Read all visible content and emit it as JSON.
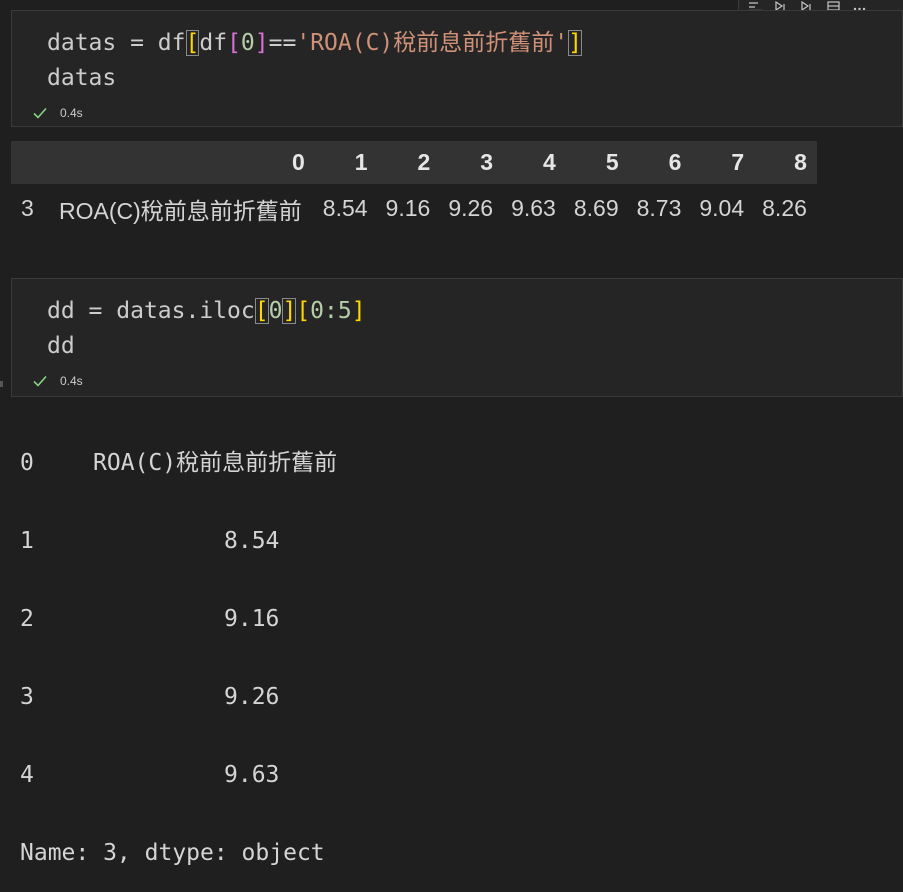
{
  "cells": [
    {
      "code_lines": [
        [
          "datas",
          " = ",
          "df",
          "[",
          "df",
          "[",
          "0",
          "]",
          "==",
          "'ROA(C)稅前息前折舊前'",
          "]"
        ],
        [
          "datas"
        ]
      ],
      "exec_time": "0.4s"
    },
    {
      "code_lines": [
        [
          "dd",
          " = ",
          "datas.iloc",
          "[",
          "0",
          "]",
          "[",
          "0:5",
          "]"
        ],
        [
          "dd"
        ]
      ],
      "exec_time": "0.4s"
    }
  ],
  "dataframe": {
    "columns": [
      "0",
      "1",
      "2",
      "3",
      "4",
      "5",
      "6",
      "7",
      "8"
    ],
    "rows": [
      {
        "index": "3",
        "values": [
          "ROA(C)稅前息前折舊前",
          "8.54",
          "9.16",
          "9.26",
          "9.63",
          "8.69",
          "8.73",
          "9.04",
          "8.26"
        ]
      }
    ]
  },
  "series": {
    "rows": [
      {
        "index": "0",
        "value": "ROA(C)稅前息前折舊前"
      },
      {
        "index": "1",
        "value": "8.54"
      },
      {
        "index": "2",
        "value": "9.16"
      },
      {
        "index": "3",
        "value": "9.26"
      },
      {
        "index": "4",
        "value": "9.63"
      }
    ],
    "footer": "Name: 3, dtype: object"
  },
  "icons": [
    "check-icon",
    "toolbar-icons"
  ],
  "colors": {
    "background": "#1f1f1f",
    "cell_background": "#252526",
    "string": "#ce9178",
    "number": "#b5cea8",
    "bracket_gold": "#ffd700",
    "bracket_purple": "#da70d6",
    "bracket_blue": "#179fff",
    "success_check": "#89d185"
  }
}
